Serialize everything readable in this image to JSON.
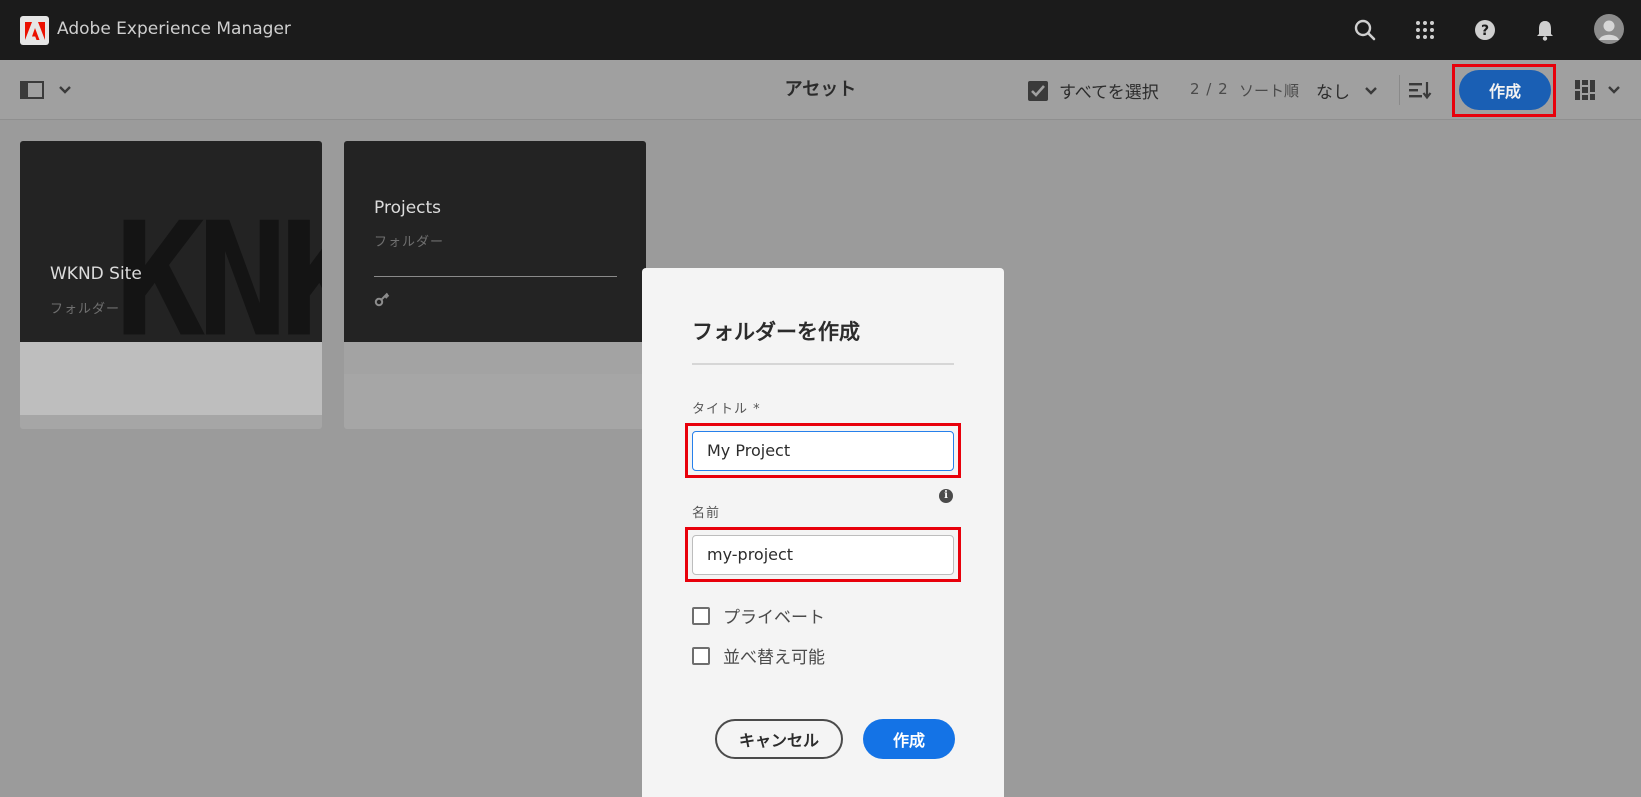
{
  "shell": {
    "title": "Adobe Experience Manager",
    "icons": [
      "search-icon",
      "apps-grid-icon",
      "help-icon",
      "notifications-bell-icon",
      "user-avatar"
    ]
  },
  "actionbar": {
    "page_title": "アセット",
    "select_all_label": "すべてを選択",
    "count": "2 / 2",
    "sort_label": "ソート順",
    "sort_value": "なし",
    "create_label": "作成"
  },
  "cards": [
    {
      "title": "WKND Site",
      "subtitle": "フォルダー",
      "thumbnail_text": "KNKN"
    },
    {
      "title": "Projects",
      "subtitle": "フォルダー"
    }
  ],
  "dialog": {
    "title": "フォルダーを作成",
    "title_field_label": "タイトル *",
    "title_value": "My Project",
    "name_field_label": "名前",
    "name_value": "my-project",
    "checkbox_private": "プライベート",
    "checkbox_orderable": "並べ替え可能",
    "cancel_label": "キャンセル",
    "create_label": "作成"
  },
  "colors": {
    "shell_bg": "#1b1b1b",
    "highlight": "#e8000b",
    "primary_button": "#1473e6",
    "adobe_red": "#eb1000"
  }
}
